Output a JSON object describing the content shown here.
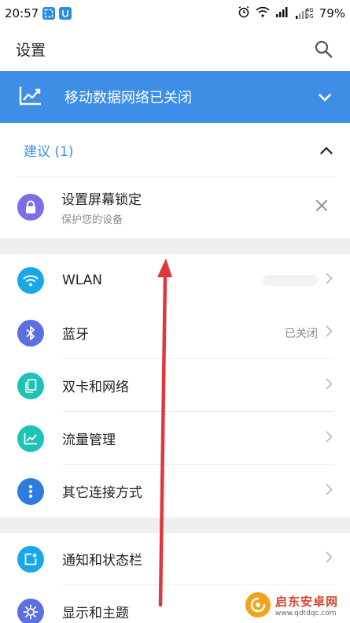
{
  "status_bar": {
    "time": "20:57",
    "battery": "79%",
    "net_top": "4G",
    "net_bottom": "2G"
  },
  "header": {
    "title": "设置"
  },
  "banner": {
    "text": "移动数据网络已关闭"
  },
  "suggestions": {
    "title": "建议 (1)",
    "item": {
      "title": "设置屏幕锁定",
      "subtitle": "保护您的设备"
    }
  },
  "sections": [
    {
      "rows": [
        {
          "label": "WLAN",
          "status": "",
          "icon": "wifi-icon",
          "color": "#1aa7e8"
        },
        {
          "label": "蓝牙",
          "status": "已关闭",
          "icon": "bluetooth-icon",
          "color": "#5b6fe0"
        },
        {
          "label": "双卡和网络",
          "status": "",
          "icon": "sim-card-icon",
          "color": "#1fc2b6"
        },
        {
          "label": "流量管理",
          "status": "",
          "icon": "data-usage-icon",
          "color": "#1fc2b6"
        },
        {
          "label": "其它连接方式",
          "status": "",
          "icon": "more-dots-icon",
          "color": "#2f7ce0"
        }
      ]
    },
    {
      "rows": [
        {
          "label": "通知和状态栏",
          "status": "",
          "icon": "notification-icon",
          "color": "#1aa7e8"
        },
        {
          "label": "显示和主题",
          "status": "",
          "icon": "brightness-icon",
          "color": "#5b6fe0"
        }
      ]
    }
  ],
  "colors": {
    "accent": "#3e8ee8",
    "lock_icon": "#7a6fe6",
    "arrow": "#e0383a"
  },
  "watermark": {
    "title": "启东安卓网",
    "url": "www.qdtdqc.com"
  }
}
